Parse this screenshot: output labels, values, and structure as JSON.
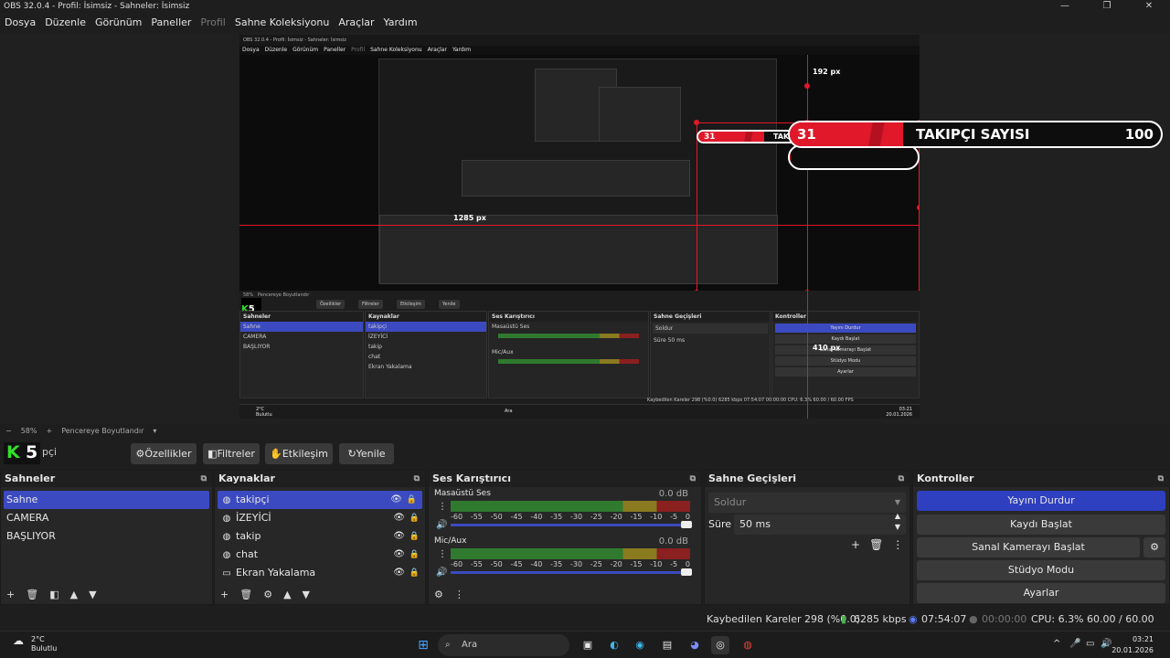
{
  "window": {
    "title": "OBS 32.0.4 - Profil: İsimsiz - Sahneler: İsimsiz",
    "minimize": "—",
    "maximize": "❐",
    "close": "✕"
  },
  "menu": [
    "Dosya",
    "Düzenle",
    "Görünüm",
    "Paneller",
    "Profil",
    "Sahne Koleksiyonu",
    "Araçlar",
    "Yardım"
  ],
  "preview": {
    "labels": {
      "px192": "192 px",
      "px1285": "1285 px",
      "px410": "410 px"
    },
    "alert": {
      "count": "31",
      "text": "TAKIPÇI SAYISI",
      "goal": "100"
    },
    "nested": {
      "title": "OBS 32.0.4 - Profil: İsimsiz - Sahneler: İsimsiz",
      "menu": [
        "Dosya",
        "Düzenle",
        "Görünüm",
        "Paneller",
        "Profil",
        "Sahne Koleksiyonu",
        "Araçlar",
        "Yardım"
      ],
      "zoom": "58%",
      "fit": "Pencereye Boyutlandır",
      "scenes_head": "Sahneler",
      "scenes": [
        "Sahne",
        "CAMERA",
        "BAŞLIYOR"
      ],
      "sources_head": "Kaynaklar",
      "sources": [
        "takipçi",
        "İZEYİCİ",
        "takip",
        "chat",
        "Ekran Yakalama"
      ],
      "mixer_head": "Ses Karıştırıcı",
      "mixer_ch1": "Masaüstü Ses",
      "mixer_ch2": "Mic/Aux",
      "db": "0.0 dB",
      "trans_head": "Sahne Geçişleri",
      "trans_value": "Soldur",
      "duration_label": "Süre",
      "duration": "50 ms",
      "controls_head": "Kontroller",
      "controls": [
        "Yayını Durdur",
        "Kaydı Başlat",
        "Sanal Kamerayı Başlat",
        "Stüdyo Modu",
        "Ayarlar"
      ],
      "toolbar": [
        "Özellikler",
        "Filtreler",
        "Etkileşim",
        "Yenile"
      ],
      "status": "Kaybedilen Kareler 298 (%0.0)   6285 kbps   07:54:07   00:00:00   CPU: 6.3%   60.00 / 60.00 FPS",
      "weather_temp": "2°C",
      "weather_text": "Bulutlu",
      "search": "Ara",
      "time": "03:21",
      "date": "20.01.2026"
    }
  },
  "zoombar": {
    "minus": "−",
    "zoom": "58%",
    "plus": "+",
    "fit": "Pencereye Boyutlandır",
    "arrow": "▾"
  },
  "scene_toolbar": {
    "logo_letter": "K",
    "logo_digit": "5",
    "scene_name": "pçi",
    "buttons": [
      "Özellikler",
      "Filtreler",
      "Etkileşim",
      "Yenile"
    ]
  },
  "scenes": {
    "head": "Sahneler",
    "items": [
      "Sahne",
      "CAMERA",
      "BAŞLIYOR"
    ]
  },
  "sources": {
    "head": "Kaynaklar",
    "items": [
      "takipçi",
      "İZEYİCİ",
      "takip",
      "chat",
      "Ekran Yakalama"
    ]
  },
  "mixer": {
    "head": "Ses Karıştırıcı",
    "channels": [
      {
        "name": "Masaüstü Ses",
        "db": "0.0 dB"
      },
      {
        "name": "Mic/Aux",
        "db": "0.0 dB"
      }
    ],
    "scale": [
      "-60",
      "-55",
      "-50",
      "-45",
      "-40",
      "-35",
      "-30",
      "-25",
      "-20",
      "-15",
      "-10",
      "-5",
      "0"
    ]
  },
  "transitions": {
    "head": "Sahne Geçişleri",
    "type": "Soldur",
    "duration_label": "Süre",
    "duration": "50 ms"
  },
  "controls": {
    "head": "Kontroller",
    "stream": "Yayını Durdur",
    "record": "Kaydı Başlat",
    "virtualcam": "Sanal Kamerayı Başlat",
    "studio": "Stüdyo Modu",
    "settings": "Ayarlar"
  },
  "status": {
    "dropped": "Kaybedilen Kareler 298 (%0.0)",
    "bitrate": "6285 kbps",
    "stream_time": "07:54:07",
    "record_time": "00:00:00",
    "cpu": "CPU: 6.3%",
    "fps": "60.00 / 60.00 FPS"
  },
  "taskbar": {
    "weather_temp": "2°C",
    "weather_text": "Bulutlu",
    "search": "Ara",
    "time": "03:21",
    "date": "20.01.2026"
  },
  "colors": {
    "accent": "#3b4ac0",
    "alert_red": "#e0182a",
    "guide_red": "#e0182a"
  }
}
